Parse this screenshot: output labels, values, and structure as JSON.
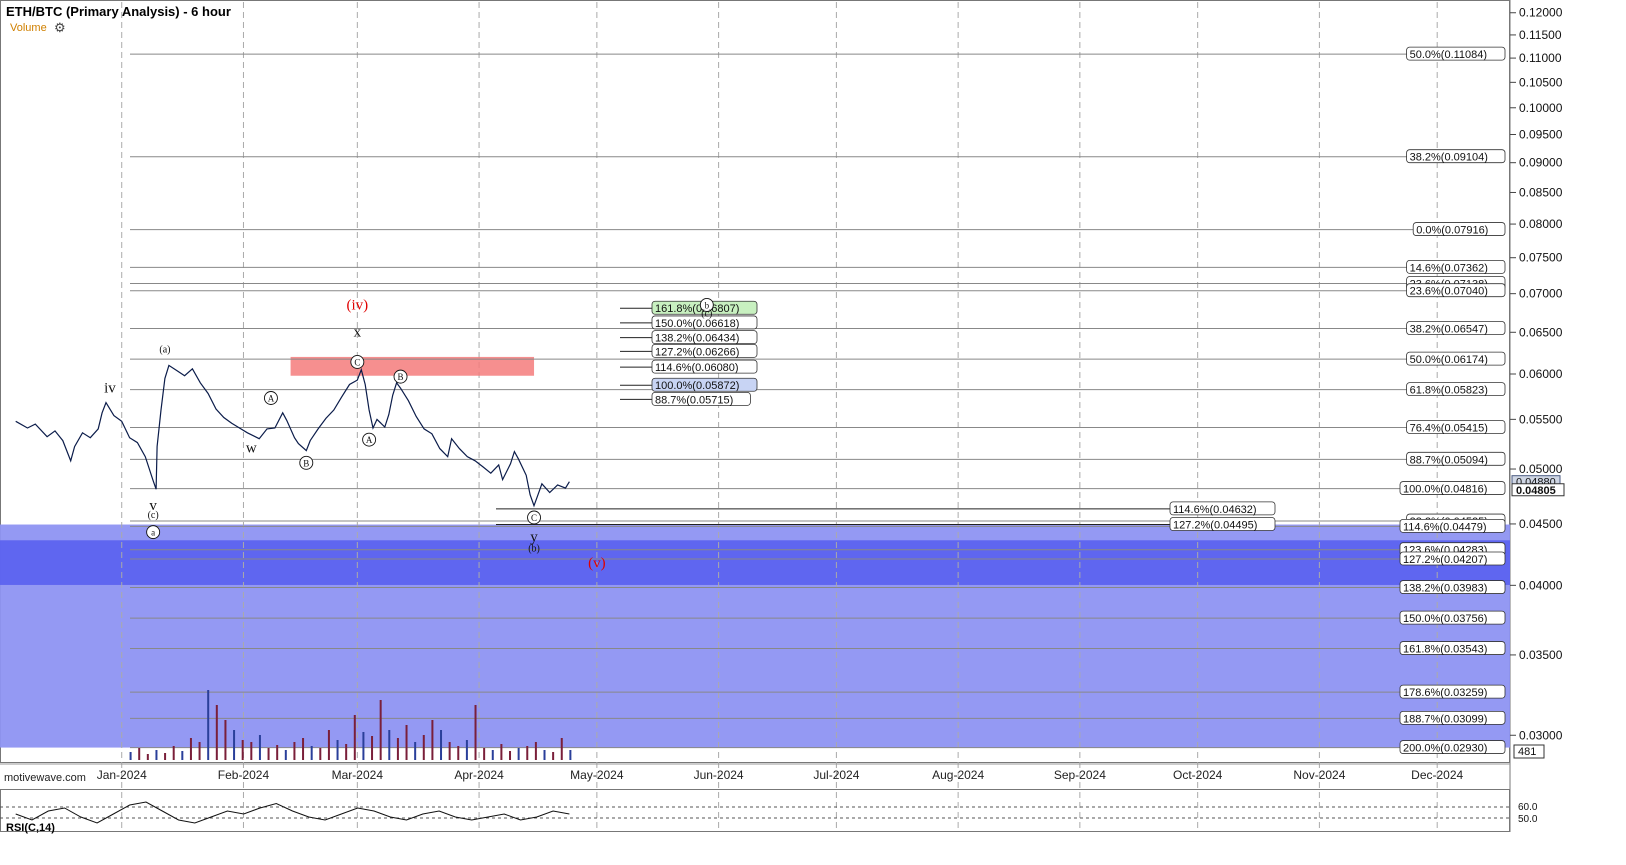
{
  "header": {
    "title": "ETH/BTC (Primary Analysis) - 6 hour",
    "volume_label": "Volume",
    "gear_icon": "gear-icon",
    "watermark": "motivewave.com"
  },
  "rsi": {
    "label": "RSI(C,14)",
    "levels": [
      "60.0",
      "50.0"
    ]
  },
  "colors": {
    "zone_light": "#8e94f2",
    "zone_dark": "#5c63ef",
    "resistance_box": "#f47b7b",
    "fib_label_green": "#c8f0c0",
    "fib_label_blue": "#c8d4f4",
    "red_label": "#e00000",
    "price_line": "#0b1c4a",
    "volume_bar": "#7a1f3a"
  },
  "chart_data": {
    "type": "line",
    "title": "ETH/BTC (Primary Analysis) - 6 hour",
    "ylim": [
      0.0285,
      0.1225
    ],
    "scale": "log",
    "grid": true,
    "x_ticks": [
      "Jan-2024",
      "Feb-2024",
      "Mar-2024",
      "Apr-2024",
      "May-2024",
      "Jun-2024",
      "Jul-2024",
      "Aug-2024",
      "Sep-2024",
      "Oct-2024",
      "Nov-2024",
      "Dec-2024"
    ],
    "y_ticks": [
      "0.12000",
      "0.11500",
      "0.11000",
      "0.10500",
      "0.10000",
      "0.09500",
      "0.09000",
      "0.08500",
      "0.08000",
      "0.07500",
      "0.07000",
      "0.06500",
      "0.06000",
      "0.05500",
      "0.05000",
      "0.04500",
      "0.04000",
      "0.03500",
      "0.03000"
    ],
    "last_price": "0.04880",
    "price_tag": "0.04805",
    "volume_tag": "481",
    "series": [
      {
        "values": [
          [
            "2023-12-05",
            0.0548
          ],
          [
            "2023-12-08",
            0.0541
          ],
          [
            "2023-12-10",
            0.0545
          ],
          [
            "2023-12-13",
            0.0532
          ],
          [
            "2023-12-15",
            0.0538
          ],
          [
            "2023-12-17",
            0.0528
          ],
          [
            "2023-12-19",
            0.0508
          ],
          [
            "2023-12-20",
            0.0522
          ],
          [
            "2023-12-22",
            0.0536
          ],
          [
            "2023-12-24",
            0.0531
          ],
          [
            "2023-12-26",
            0.054
          ],
          [
            "2023-12-27",
            0.0557
          ],
          [
            "2023-12-28",
            0.0568
          ],
          [
            "2023-12-30",
            0.0554
          ],
          [
            "2024-01-01",
            0.0548
          ],
          [
            "2024-01-03",
            0.0531
          ],
          [
            "2024-01-05",
            0.0526
          ],
          [
            "2024-01-07",
            0.0512
          ],
          [
            "2024-01-09",
            0.0489
          ],
          [
            "2024-01-09T18",
            0.0481
          ],
          [
            "2024-01-10",
            0.0522
          ],
          [
            "2024-01-11",
            0.056
          ],
          [
            "2024-01-12",
            0.0595
          ],
          [
            "2024-01-13",
            0.061
          ],
          [
            "2024-01-15",
            0.0604
          ],
          [
            "2024-01-17",
            0.0598
          ],
          [
            "2024-01-19",
            0.0606
          ],
          [
            "2024-01-21",
            0.059
          ],
          [
            "2024-01-23",
            0.0578
          ],
          [
            "2024-01-25",
            0.0561
          ],
          [
            "2024-01-27",
            0.0552
          ],
          [
            "2024-01-29",
            0.0546
          ],
          [
            "2024-01-31",
            0.0541
          ],
          [
            "2024-02-02",
            0.0536
          ],
          [
            "2024-02-05",
            0.053
          ],
          [
            "2024-02-07",
            0.054
          ],
          [
            "2024-02-09",
            0.0541
          ],
          [
            "2024-02-11",
            0.0557
          ],
          [
            "2024-02-12",
            0.0549
          ],
          [
            "2024-02-14",
            0.0531
          ],
          [
            "2024-02-15",
            0.0525
          ],
          [
            "2024-02-17",
            0.0518
          ],
          [
            "2024-02-18",
            0.0528
          ],
          [
            "2024-02-20",
            0.054
          ],
          [
            "2024-02-22",
            0.0551
          ],
          [
            "2024-02-24",
            0.056
          ],
          [
            "2024-02-26",
            0.0574
          ],
          [
            "2024-02-28",
            0.0588
          ],
          [
            "2024-03-01",
            0.0593
          ],
          [
            "2024-03-02",
            0.0605
          ],
          [
            "2024-03-03",
            0.0588
          ],
          [
            "2024-03-04",
            0.056
          ],
          [
            "2024-03-05",
            0.0541
          ],
          [
            "2024-03-06",
            0.055
          ],
          [
            "2024-03-08",
            0.0542
          ],
          [
            "2024-03-09",
            0.0555
          ],
          [
            "2024-03-10",
            0.0576
          ],
          [
            "2024-03-11",
            0.059
          ],
          [
            "2024-03-12",
            0.0584
          ],
          [
            "2024-03-14",
            0.057
          ],
          [
            "2024-03-16",
            0.0553
          ],
          [
            "2024-03-18",
            0.054
          ],
          [
            "2024-03-20",
            0.0535
          ],
          [
            "2024-03-22",
            0.052
          ],
          [
            "2024-03-24",
            0.0512
          ],
          [
            "2024-03-25",
            0.053
          ],
          [
            "2024-03-27",
            0.052
          ],
          [
            "2024-03-29",
            0.0512
          ],
          [
            "2024-03-31",
            0.0508
          ],
          [
            "2024-04-02",
            0.0502
          ],
          [
            "2024-04-04",
            0.0496
          ],
          [
            "2024-04-06",
            0.0504
          ],
          [
            "2024-04-07",
            0.049
          ],
          [
            "2024-04-09",
            0.0505
          ],
          [
            "2024-04-10",
            0.0517
          ],
          [
            "2024-04-11",
            0.051
          ],
          [
            "2024-04-13",
            0.0494
          ],
          [
            "2024-04-14",
            0.0476
          ],
          [
            "2024-04-15",
            0.0466
          ],
          [
            "2024-04-16",
            0.0476
          ],
          [
            "2024-04-17",
            0.0486
          ],
          [
            "2024-04-19",
            0.0478
          ],
          [
            "2024-04-21",
            0.0485
          ],
          [
            "2024-04-23",
            0.0482
          ],
          [
            "2024-04-24",
            0.0488
          ]
        ]
      }
    ],
    "zones": [
      {
        "from": 0.04495,
        "to": 0.0293,
        "shade": "light"
      },
      {
        "from": 0.04361,
        "to": 0.04003,
        "shade": "dark"
      },
      {
        "from": 0.062,
        "to": 0.0598,
        "shade": "resistance",
        "x_from": "2024-02-13",
        "x_to": "2024-04-15"
      }
    ],
    "fib_lines_right": [
      {
        "label": "50.0%(0.11084)",
        "value": 0.11084
      },
      {
        "label": "38.2%(0.09104)",
        "value": 0.09104
      },
      {
        "label": "0.0%(0.07916)",
        "value": 0.07916
      },
      {
        "label": "14.6%(0.07362)",
        "value": 0.07362
      },
      {
        "label": "23.6%(0.07138)",
        "value": 0.07138
      },
      {
        "label": "23.6%(0.07040)",
        "value": 0.0704
      },
      {
        "label": "38.2%(0.06547)",
        "value": 0.06547
      },
      {
        "label": "50.0%(0.06174)",
        "value": 0.06174
      },
      {
        "label": "61.8%(0.05823)",
        "value": 0.05823
      },
      {
        "label": "76.4%(0.05415)",
        "value": 0.05415
      },
      {
        "label": "88.7%(0.05094)",
        "value": 0.05094
      },
      {
        "label": "100.0%(0.04816)",
        "value": 0.04816
      },
      {
        "label": "38.2%(0.04525)",
        "value": 0.04525
      },
      {
        "label": "114.6%(0.04479)",
        "value": 0.04479
      },
      {
        "label": "123.6%(0.04283)",
        "value": 0.04283
      },
      {
        "label": "127.2%(0.04207)",
        "value": 0.04207
      },
      {
        "label": "138.2%(0.03983)",
        "value": 0.03983
      },
      {
        "label": "150.0%(0.03756)",
        "value": 0.03756
      },
      {
        "label": "161.8%(0.03543)",
        "value": 0.03543
      },
      {
        "label": "178.6%(0.03259)",
        "value": 0.03259
      },
      {
        "label": "188.7%(0.03099)",
        "value": 0.03099
      },
      {
        "label": "200.0%(0.02930)",
        "value": 0.0293
      }
    ],
    "fib_lines_mid": [
      {
        "label": "114.6%(0.04632)",
        "value": 0.04632
      },
      {
        "label": "127.2%(0.04495)",
        "value": 0.04495
      }
    ],
    "fib_lines_upper": [
      {
        "label": "161.8%(0.06807)",
        "value": 0.06807,
        "fill": "green"
      },
      {
        "label": "150.0%(0.06618)",
        "value": 0.06618
      },
      {
        "label": "138.2%(0.06434)",
        "value": 0.06434
      },
      {
        "label": "127.2%(0.06266)",
        "value": 0.06266
      },
      {
        "label": "114.6%(0.06080)",
        "value": 0.0608
      },
      {
        "label": "100.0%(0.05872)",
        "value": 0.05872,
        "fill": "blue"
      },
      {
        "label": "88.7%(0.05715)",
        "value": 0.05715
      }
    ],
    "wave_labels": [
      {
        "text": "iv",
        "x": "2023-12-29",
        "y": 0.0579,
        "style": "plain",
        "color": "black"
      },
      {
        "text": "v",
        "x": "2024-01-09",
        "y": 0.0462,
        "style": "plain",
        "color": "black"
      },
      {
        "text": "(c)",
        "x": "2024-01-09",
        "y": 0.0455,
        "style": "small",
        "color": "black"
      },
      {
        "text": "a",
        "x": "2024-01-09",
        "y": 0.0443,
        "style": "circle",
        "color": "black"
      },
      {
        "text": "(a)",
        "x": "2024-01-12",
        "y": 0.0625,
        "style": "small",
        "color": "black"
      },
      {
        "text": "A",
        "x": "2024-02-08",
        "y": 0.0573,
        "style": "circle",
        "color": "black"
      },
      {
        "text": "w",
        "x": "2024-02-03",
        "y": 0.0516,
        "style": "plain",
        "color": "black"
      },
      {
        "text": "B",
        "x": "2024-02-17",
        "y": 0.0506,
        "style": "circle",
        "color": "black"
      },
      {
        "text": "(iv)",
        "x": "2024-03-01",
        "y": 0.0679,
        "style": "plain",
        "color": "red"
      },
      {
        "text": "x",
        "x": "2024-03-01",
        "y": 0.0645,
        "style": "plain",
        "color": "black"
      },
      {
        "text": "C",
        "x": "2024-03-01",
        "y": 0.0614,
        "style": "circle",
        "color": "black"
      },
      {
        "text": "A",
        "x": "2024-03-04",
        "y": 0.0529,
        "style": "circle",
        "color": "black"
      },
      {
        "text": "B",
        "x": "2024-03-12",
        "y": 0.0597,
        "style": "circle",
        "color": "black"
      },
      {
        "text": "C",
        "x": "2024-04-15",
        "y": 0.04556,
        "style": "circle",
        "color": "black"
      },
      {
        "text": "y",
        "x": "2024-04-15",
        "y": 0.0435,
        "style": "plain",
        "color": "black"
      },
      {
        "text": "(b)",
        "x": "2024-04-15",
        "y": 0.0427,
        "style": "small",
        "color": "black"
      },
      {
        "text": "(v)",
        "x": "2024-05-01",
        "y": 0.0414,
        "style": "plain",
        "color": "red"
      },
      {
        "text": "b",
        "x": "2024-05-29",
        "y": 0.0685,
        "style": "circle",
        "color": "black"
      },
      {
        "text": "(c)",
        "x": "2024-05-29",
        "y": 0.067,
        "style": "small",
        "color": "black"
      }
    ]
  }
}
